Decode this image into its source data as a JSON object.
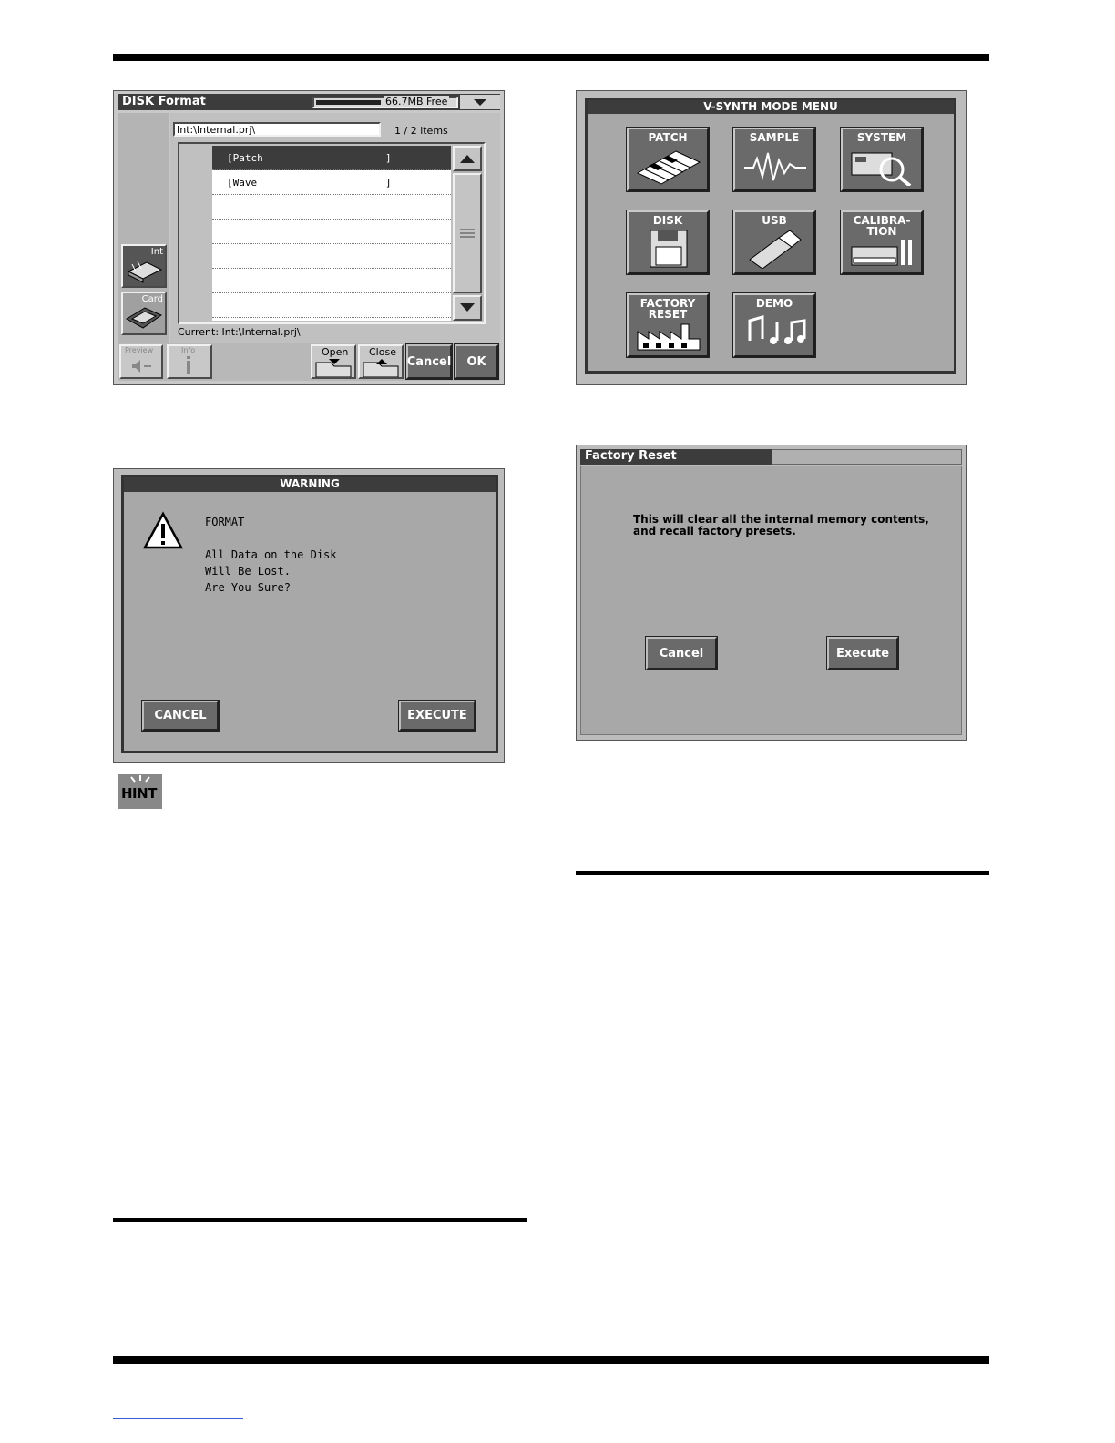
{
  "disk_format": {
    "title": "DISK Format",
    "free": "66.7MB Free",
    "path": "Int:\\Internal.prj\\",
    "items_count": "1 / 2 items",
    "list": [
      {
        "name": "[Patch",
        "end": "]"
      },
      {
        "name": "[Wave",
        "end": "]"
      }
    ],
    "current": "Current: Int:\\Internal.prj\\",
    "side_int": "Int",
    "side_card": "Card",
    "btn_preview": "Preview",
    "btn_info": "Info",
    "btn_open": "Open",
    "btn_close": "Close",
    "btn_cancel": "Cancel",
    "btn_ok": "OK"
  },
  "mode_menu": {
    "title": "V-SYNTH MODE MENU",
    "items": [
      {
        "label": "PATCH",
        "icon": "piano-keys-icon"
      },
      {
        "label": "SAMPLE",
        "icon": "waveform-icon"
      },
      {
        "label": "SYSTEM",
        "icon": "synth-magnifier-icon"
      },
      {
        "label": "DISK",
        "icon": "floppy-disk-icon"
      },
      {
        "label": "USB",
        "icon": "usb-plug-icon"
      },
      {
        "label1": "CALIBRA-",
        "label2": "TION",
        "icon": "calibration-tools-icon"
      },
      {
        "label1": "FACTORY",
        "label2": "RESET",
        "icon": "factory-icon"
      },
      {
        "label": "DEMO",
        "icon": "music-notes-icon"
      }
    ]
  },
  "warning": {
    "title": "WARNING",
    "line1": "FORMAT",
    "line2": "All Data on the Disk",
    "line3": "Will Be Lost.",
    "line4": "Are You Sure?",
    "cancel": "CANCEL",
    "execute": "EXECUTE"
  },
  "factory_reset": {
    "title": "Factory Reset",
    "message1": "This will clear all the internal memory contents,",
    "message2": "and recall factory presets.",
    "cancel": "Cancel",
    "execute": "Execute"
  },
  "hint_badge": "HINT"
}
